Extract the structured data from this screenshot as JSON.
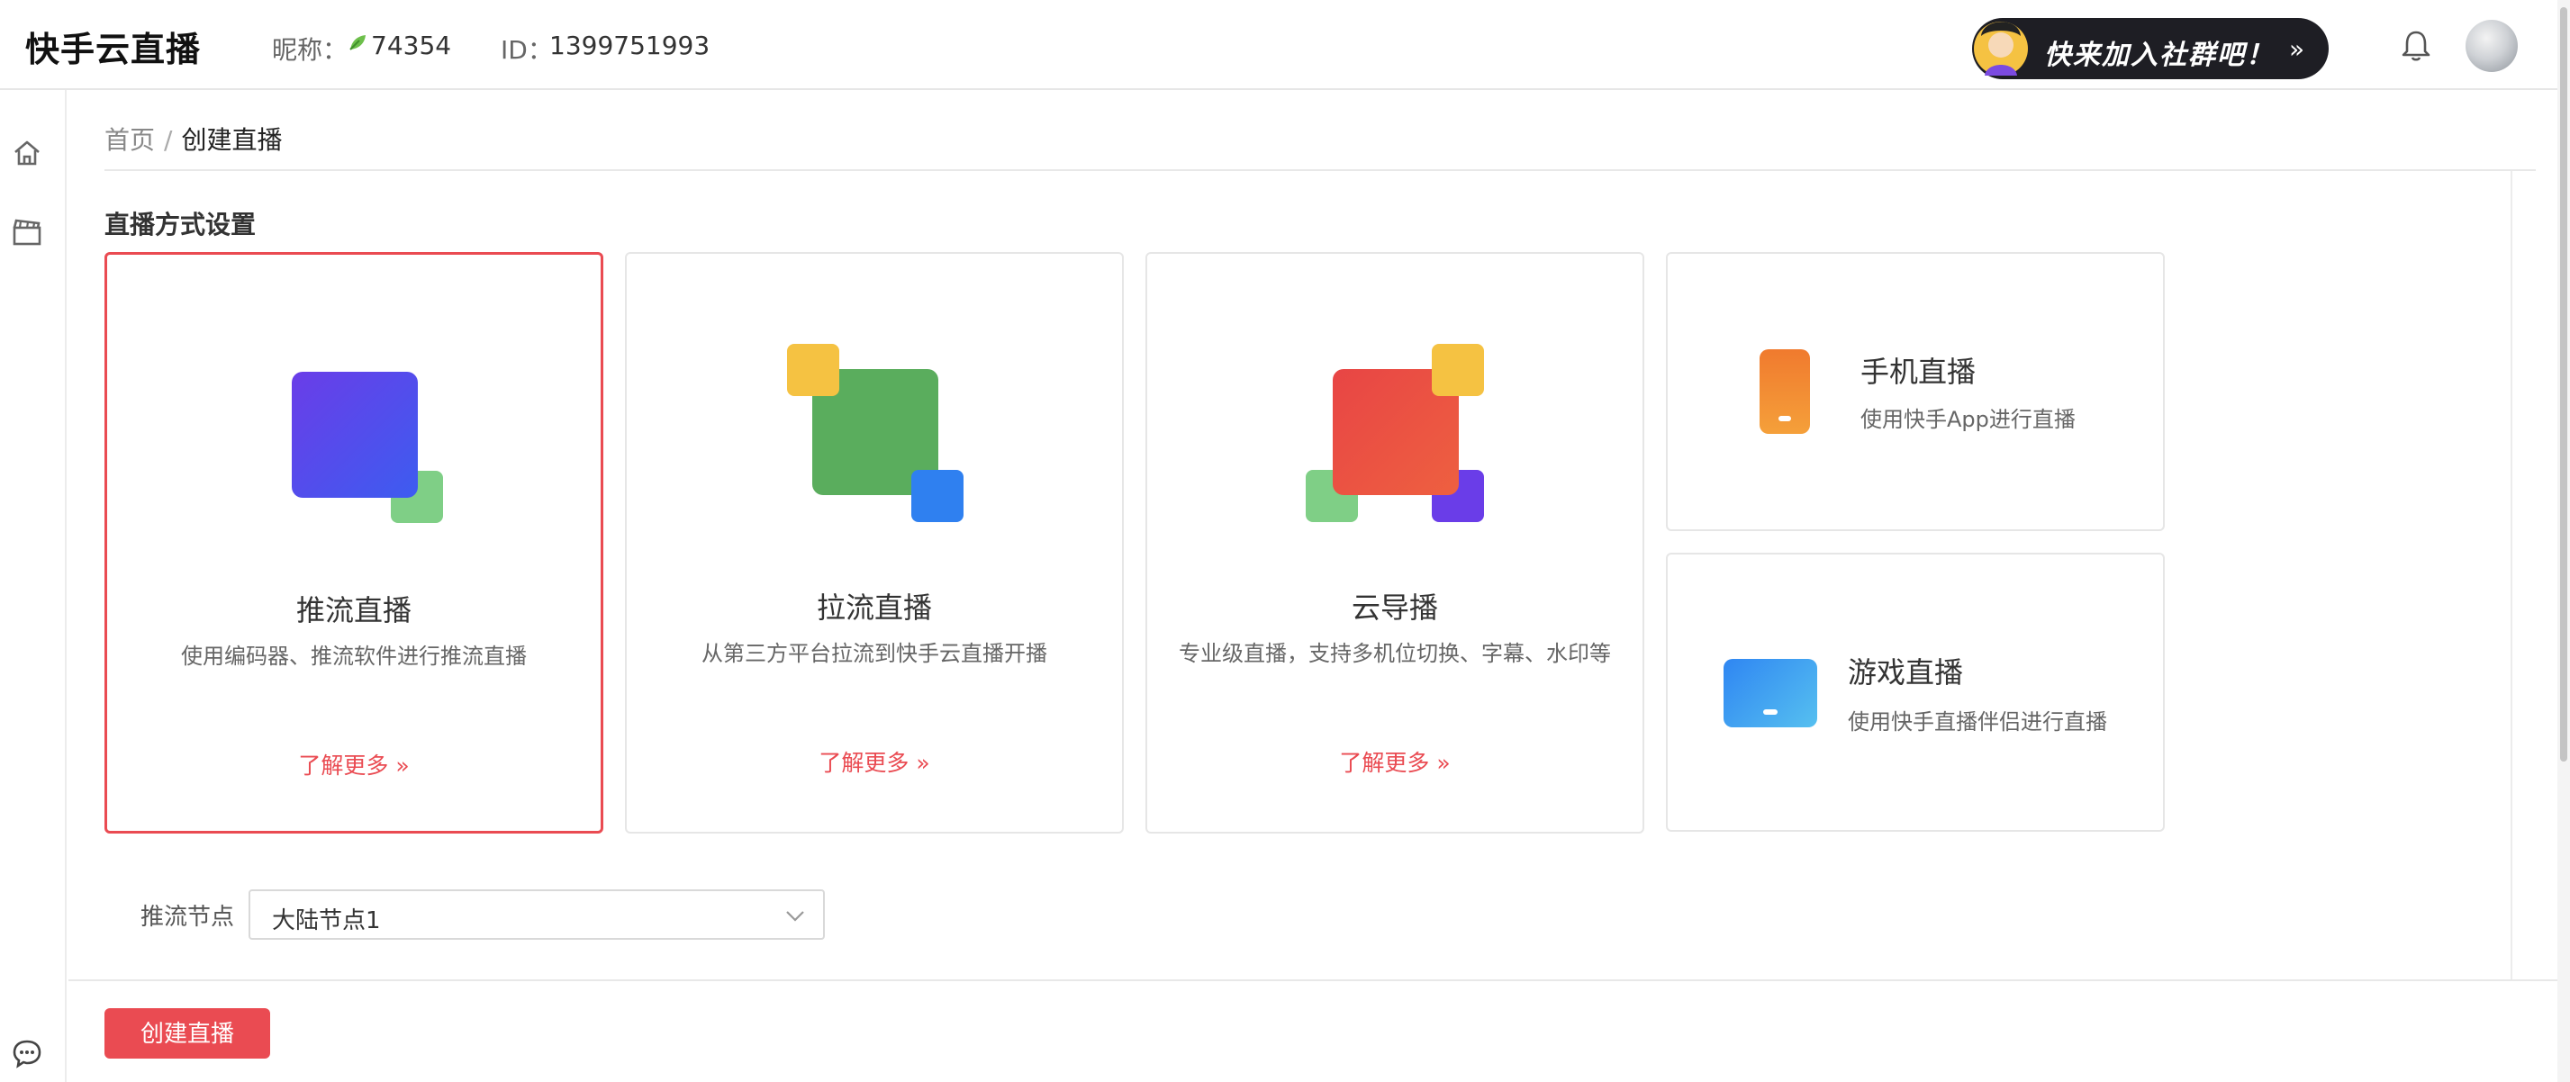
{
  "header": {
    "logo": "快手云直播",
    "nickname_label": "昵称：",
    "nickname_value": "74354",
    "id_label": "ID：",
    "id_value": "1399751993",
    "join_banner": "快来加入社群吧！",
    "join_arrow": "»"
  },
  "breadcrumb": {
    "home": "首页",
    "separator": "/",
    "current": "创建直播"
  },
  "section": {
    "title": "直播方式设置"
  },
  "cards": [
    {
      "title": "推流直播",
      "desc": "使用编码器、推流软件进行推流直播",
      "more": "了解更多 »"
    },
    {
      "title": "拉流直播",
      "desc": "从第三方平台拉流到快手云直播开播",
      "more": "了解更多 »"
    },
    {
      "title": "云导播",
      "desc": "专业级直播，支持多机位切换、字幕、水印等",
      "more": "了解更多 »"
    }
  ],
  "side_cards": [
    {
      "title": "手机直播",
      "desc": "使用快手App进行直播"
    },
    {
      "title": "游戏直播",
      "desc": "使用快手直播伴侣进行直播"
    }
  ],
  "node": {
    "label": "推流节点",
    "value": "大陆节点1"
  },
  "footer": {
    "create_button": "创建直播"
  },
  "colors": {
    "accent": "#ea4b52",
    "purple": "#6a3de8",
    "green": "#5aad5d",
    "yellow": "#f5c242",
    "blue": "#2f80f0",
    "red": "#e84545",
    "orange": "#f08a2e",
    "sky": "#3e9cf4"
  },
  "icons": {
    "home": "home-icon",
    "video": "clapperboard-icon",
    "chat": "chat-icon",
    "bell": "bell-icon"
  }
}
